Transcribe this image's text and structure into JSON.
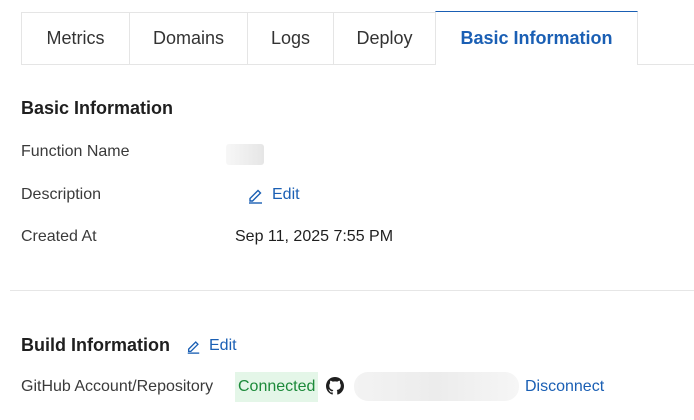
{
  "tabs": [
    {
      "label": "Metrics",
      "active": false
    },
    {
      "label": "Domains",
      "active": false
    },
    {
      "label": "Logs",
      "active": false
    },
    {
      "label": "Deploy",
      "active": false
    },
    {
      "label": "Basic Information",
      "active": true
    }
  ],
  "basic_info": {
    "title": "Basic Information",
    "function_name_label": "Function Name",
    "description_label": "Description",
    "description_edit": "Edit",
    "created_at_label": "Created At",
    "created_at_value": "Sep 11, 2025 7:55 PM"
  },
  "build_info": {
    "title": "Build Information",
    "edit": "Edit",
    "github_label": "GitHub Account/Repository",
    "status": "Connected",
    "disconnect": "Disconnect"
  },
  "colors": {
    "accent": "#1a5fb4",
    "connected_bg": "#e4f6e8",
    "connected_text": "#1c8a3a"
  },
  "icons": {
    "edit": "pencil-edit-icon",
    "github": "github-icon"
  }
}
